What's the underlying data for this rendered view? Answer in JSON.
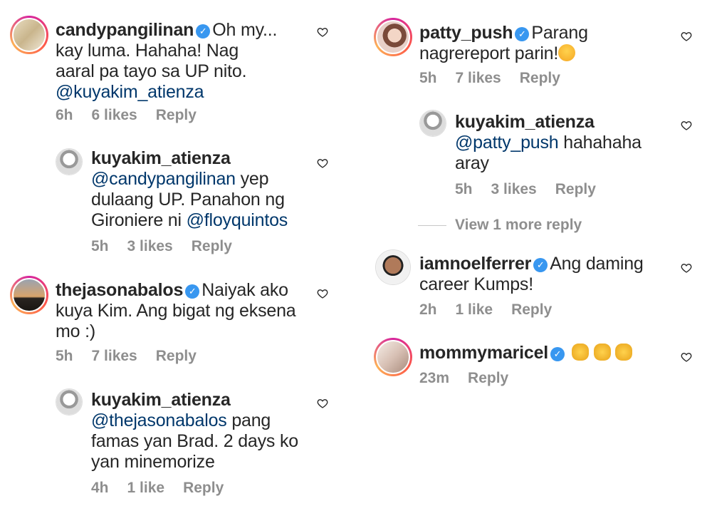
{
  "comments": {
    "c1": {
      "user": "candypangilinan",
      "text1": "Oh my...",
      "text2": "kay luma. Hahaha! Nag",
      "text3": "aaral pa tayo sa UP nito.",
      "mention": "@kuyakim_atienza",
      "time": "6h",
      "likes": "6 likes",
      "reply": "Reply"
    },
    "r1": {
      "user": "kuyakim_atienza",
      "mention": "@candypangilinan",
      "text1": " yep",
      "text2": "dulaang UP. Panahon ng",
      "text3": "Gironiere ni ",
      "mention2": "@floyquintos",
      "time": "5h",
      "likes": "3 likes",
      "reply": "Reply"
    },
    "c2": {
      "user": "thejasonabalos",
      "text1": "Naiyak ako",
      "text2": "kuya Kim. Ang bigat ng eksena",
      "text3": "mo :)",
      "time": "5h",
      "likes": "7 likes",
      "reply": "Reply"
    },
    "r2": {
      "user": "kuyakim_atienza",
      "mention": "@thejasonabalos",
      "text1": " pang",
      "text2": "famas yan Brad. 2 days ko",
      "text3": "yan minemorize",
      "time": "4h",
      "likes": "1 like",
      "reply": "Reply"
    },
    "c3": {
      "user": "patty_push",
      "text1": "Parang",
      "text2": "nagrereport parin!",
      "time": "5h",
      "likes": "7 likes",
      "reply": "Reply"
    },
    "r3": {
      "user": "kuyakim_atienza",
      "mention": "@patty_push",
      "text1": " hahahaha",
      "text2": "aray",
      "time": "5h",
      "likes": "3 likes",
      "reply": "Reply"
    },
    "viewmore": "View 1 more reply",
    "c4": {
      "user": "iamnoelferrer",
      "text1": "Ang daming",
      "text2": "career Kumps!",
      "time": "2h",
      "likes": "1 like",
      "reply": "Reply"
    },
    "c5": {
      "user": "mommymaricel",
      "time": "23m",
      "reply": "Reply"
    }
  },
  "colors": {
    "mention": "#00376b",
    "meta": "#8e8e8e",
    "verified": "#3897f0"
  },
  "icons": {
    "heart": "heart-outline-icon",
    "verified": "verified-badge-icon",
    "emoji_laugh": "laughing-emoji",
    "emoji_clap": "clapping-hands-emoji"
  }
}
